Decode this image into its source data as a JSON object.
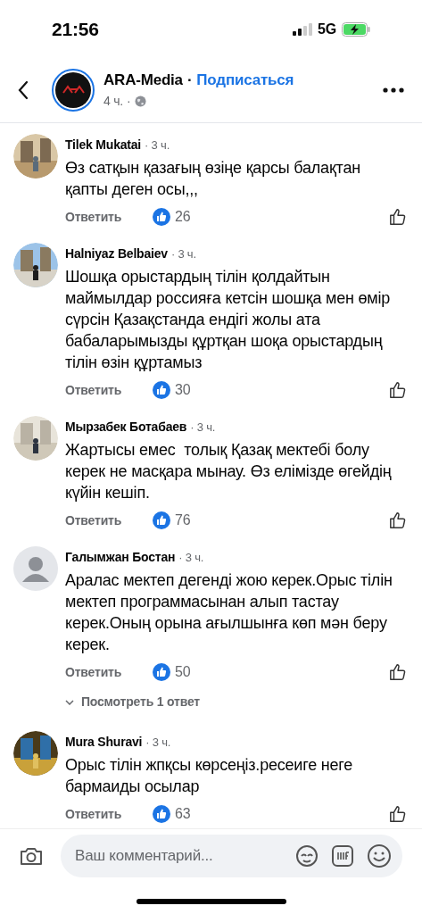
{
  "status_bar": {
    "time": "21:56",
    "network": "5G"
  },
  "header": {
    "page_name": "ARA-Media",
    "separator": "·",
    "follow_label": "Подписаться",
    "post_age": "4 ч.",
    "dot": "·"
  },
  "comments": [
    {
      "name": "Tilek Mukatai",
      "time": "· 3 ч.",
      "text": "Өз сатқын қазағың өзіңе қарсы балақтан қапты деген осы,,,",
      "reply_label": "Ответить",
      "likes": "26"
    },
    {
      "name": "Halniyaz Belbaiev",
      "time": "· 3 ч.",
      "text": "Шошқа орыстардың тілін қолдайтын маймылдар россияға кетсін шошқа мен өмір сүрсін Қазақстанда ендігі жолы ата бабаларымызды құртқан шоқа орыстардың тілін өзін құртамыз",
      "reply_label": "Ответить",
      "likes": "30"
    },
    {
      "name": "Мырзабек Ботабаев",
      "time": "· 3 ч.",
      "text": "Жартысы емес  толық Қазақ мектебі болу керек не масқара мынау. Өз елімізде өгейдің күйін кешіп.",
      "reply_label": "Ответить",
      "likes": "76"
    },
    {
      "name": "Галымжан Бостан",
      "time": "· 3 ч.",
      "text": "Аралас мектеп дегенді жою керек.Орыс тілін мектеп программасынан алып тастау керек.Оның орына ағылшынға көп мән беру керек.",
      "reply_label": "Ответить",
      "likes": "50",
      "avatar": {
        "kind": "default"
      },
      "replies_link": "Посмотреть 1 ответ"
    },
    {
      "name": "Mura Shuravi",
      "time": "· 3 ч.",
      "text": "Орыс тілін жпқсы көрсеңіз.ресеиге неге бармаиды осылар",
      "reply_label": "Ответить",
      "likes": "63"
    }
  ],
  "composer": {
    "placeholder": "Ваш комментарий..."
  }
}
